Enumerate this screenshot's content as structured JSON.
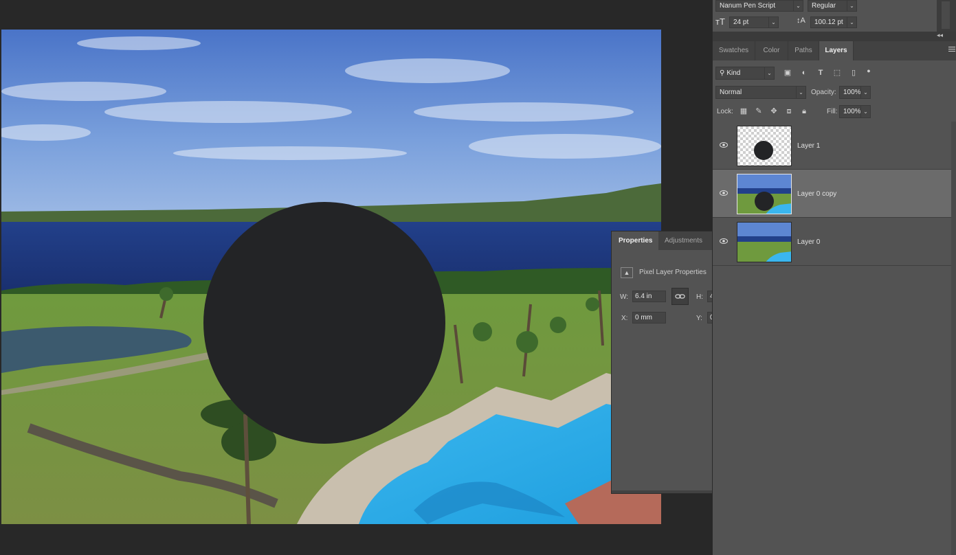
{
  "character_panel": {
    "font_family": "Nanum Pen Script",
    "font_style": "Regular",
    "font_size": "24 pt",
    "leading": "100.12 pt"
  },
  "tabs": [
    {
      "label": "Swatches",
      "active": false
    },
    {
      "label": "Color",
      "active": false
    },
    {
      "label": "Paths",
      "active": false
    },
    {
      "label": "Layers",
      "active": true
    }
  ],
  "layers_panel": {
    "filter_kind": "Kind",
    "blend_mode": "Normal",
    "opacity_label": "Opacity:",
    "opacity_value": "100%",
    "lock_label": "Lock:",
    "fill_label": "Fill:",
    "fill_value": "100%",
    "layers": [
      {
        "name": "Layer 1",
        "thumbnail": "transparent-with-black-circle",
        "visible": true,
        "selected": false
      },
      {
        "name": "Layer 0 copy",
        "thumbnail": "resort-photo",
        "visible": true,
        "selected": true
      },
      {
        "name": "Layer 0",
        "thumbnail": "resort-photo",
        "visible": true,
        "selected": false
      }
    ]
  },
  "properties_panel": {
    "tabs": [
      {
        "label": "Properties",
        "active": true
      },
      {
        "label": "Adjustments",
        "active": false
      }
    ],
    "section_title": "Pixel Layer Properties",
    "w_label": "W:",
    "w_value": "6.4 in",
    "h_label": "H:",
    "h_value": "4",
    "x_label": "X:",
    "x_value": "0 mm",
    "y_label": "Y:",
    "y_value": "0"
  },
  "colors": {
    "workspace_bg": "#282828",
    "panel_bg": "#535353",
    "selected_row": "#6b6b6b",
    "circle": "#232426"
  }
}
